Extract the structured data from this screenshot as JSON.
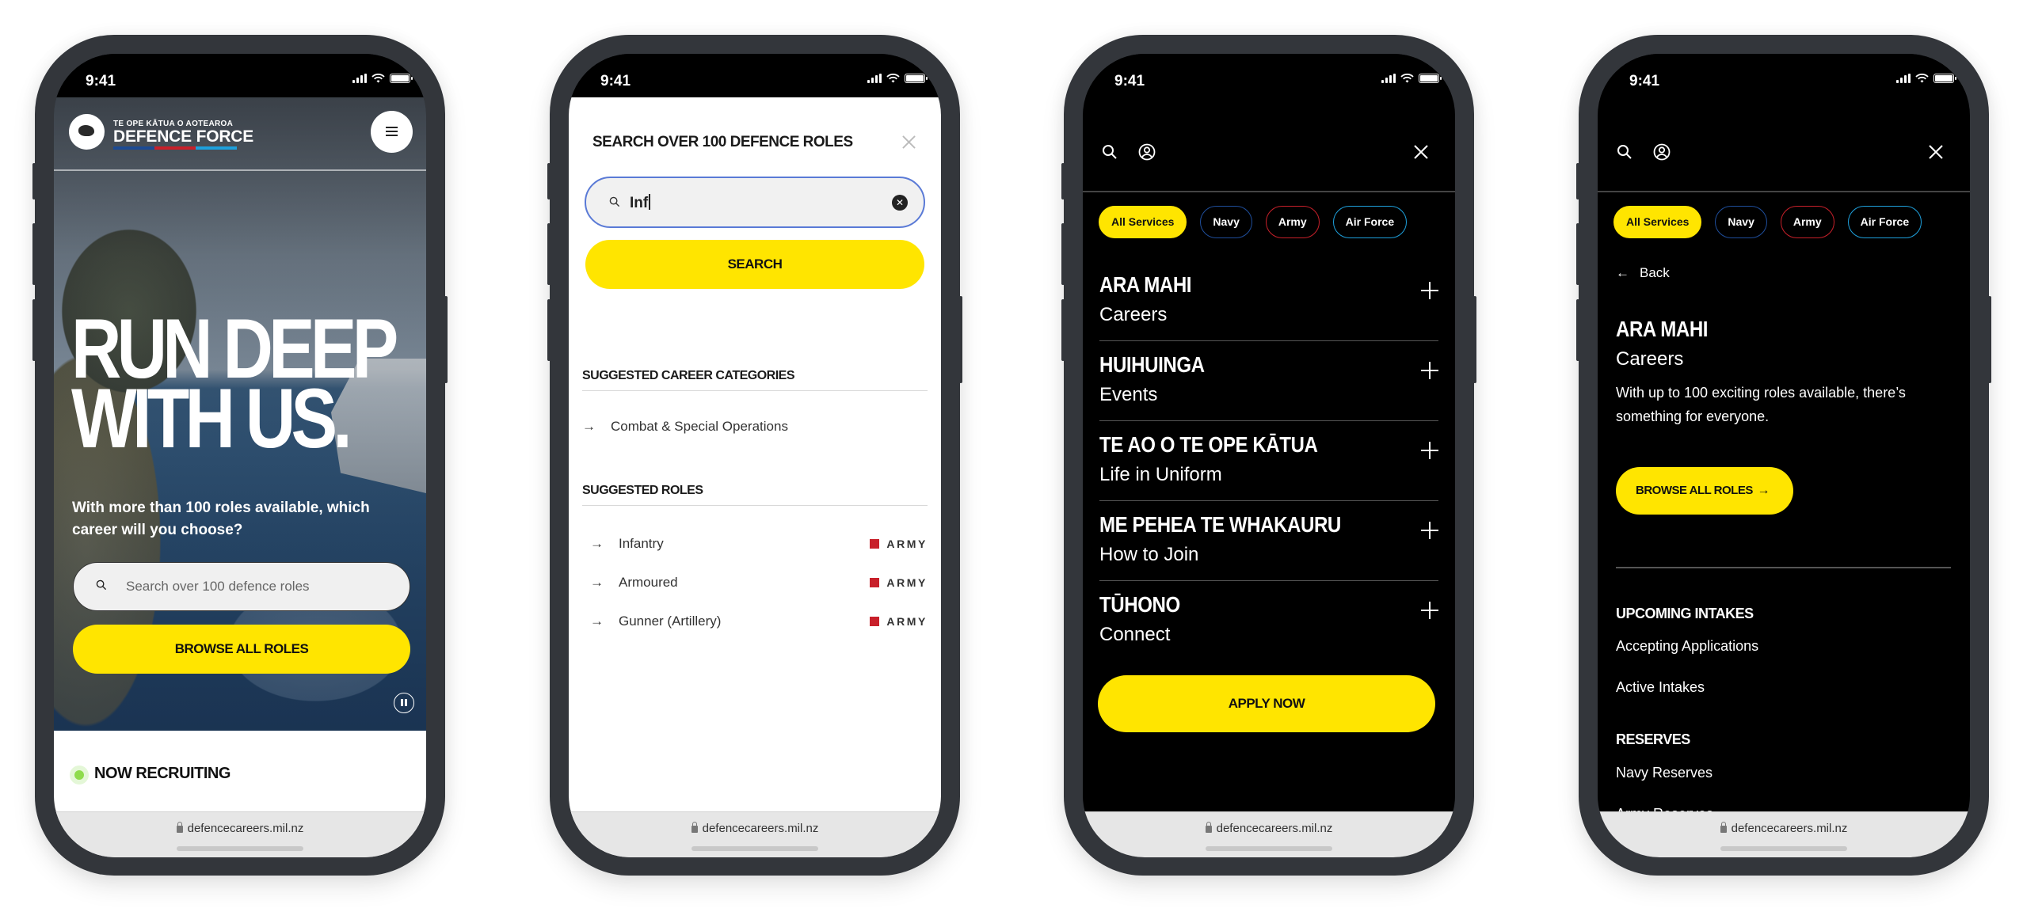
{
  "status_bar": {
    "time": "9:41"
  },
  "browser": {
    "url": "defencecareers.mil.nz"
  },
  "colors": {
    "accent_yellow": "#ffe500",
    "navy": "#1f4e9c",
    "army": "#c8202a",
    "air_force": "#1ea0dc",
    "recruiting_green": "#8fdc4d",
    "focus_blue": "#5a7ad6"
  },
  "home": {
    "logo": {
      "tagline": "TE OPE KĀTUA O AOTEAROA",
      "name": "DEFENCE FORCE"
    },
    "menu_icon": "hamburger-icon",
    "headline_lines": [
      "RUN DEEP",
      "WITH US."
    ],
    "subhead": "With more than 100 roles available, which career will you choose?",
    "search_placeholder": "Search over 100 defence roles",
    "browse_label": "BROWSE ALL ROLES",
    "pause_icon": "pause-icon",
    "recruiting_label": "NOW RECRUITING"
  },
  "search": {
    "title": "SEARCH OVER 100 DEFENCE ROLES",
    "input_value": "Inf",
    "button_label": "SEARCH",
    "categories_title": "SUGGESTED CAREER CATEGORIES",
    "categories": [
      {
        "label": "Combat & Special Operations"
      }
    ],
    "roles_title": "SUGGESTED ROLES",
    "roles": [
      {
        "label": "Infantry",
        "service": "ARMY"
      },
      {
        "label": "Armoured",
        "service": "ARMY"
      },
      {
        "label": "Gunner (Artillery)",
        "service": "ARMY"
      }
    ]
  },
  "service_filters": [
    {
      "label": "All Services",
      "active": true
    },
    {
      "label": "Navy",
      "active": false
    },
    {
      "label": "Army",
      "active": false
    },
    {
      "label": "Air Force",
      "active": false
    }
  ],
  "menu": {
    "items": [
      {
        "title": "ARA MAHI",
        "subtitle": "Careers"
      },
      {
        "title": "HUIHUINGA",
        "subtitle": "Events"
      },
      {
        "title": "TE AO O TE OPE KĀTUA",
        "subtitle": "Life in Uniform"
      },
      {
        "title": "ME PEHEA TE WHAKAURU",
        "subtitle": "How to Join"
      },
      {
        "title": "TŪHONO",
        "subtitle": "Connect"
      }
    ],
    "apply_label": "APPLY NOW"
  },
  "careers_submenu": {
    "back_label": "Back",
    "title": "ARA MAHI",
    "subtitle": "Careers",
    "description": "With up to 100 exciting roles available, there’s something for everyone.",
    "browse_label": "BROWSE ALL ROLES",
    "groups": [
      {
        "title": "UPCOMING INTAKES",
        "links": [
          "Accepting Applications",
          "Active Intakes"
        ]
      },
      {
        "title": "RESERVES",
        "links": [
          "Navy Reserves",
          "Army Reserves"
        ]
      }
    ]
  }
}
